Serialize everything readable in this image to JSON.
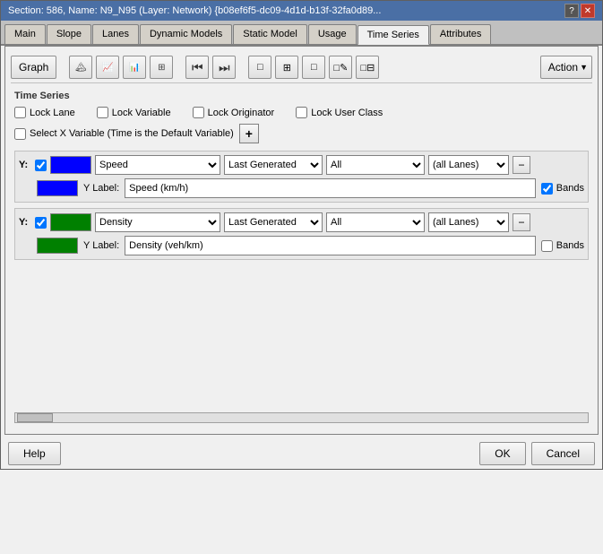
{
  "titleBar": {
    "text": "Section: 586, Name: N9_N95 (Layer: Network) {b08ef6f5-dc09-4d1d-b13f-32fa0d89...",
    "helpBtn": "?",
    "closeBtn": "✕"
  },
  "tabs": {
    "items": [
      "Main",
      "Slope",
      "Lanes",
      "Dynamic Models",
      "Static Model",
      "Usage",
      "Time Series",
      "Attributes"
    ],
    "active": "Time Series"
  },
  "toolbar": {
    "graphLabel": "Graph",
    "actionLabel": "Action",
    "icons": {
      "img1": "🖼",
      "img2": "🖼",
      "img3": "🖼",
      "img4": "⊞",
      "skipBack": "⏮",
      "skipFwd": "⏭",
      "sq1": "□",
      "grid1": "⊟",
      "sq2": "□",
      "sq3": "□",
      "sq4": "□"
    }
  },
  "timeSeries": {
    "sectionLabel": "Time Series",
    "checkboxes": {
      "lockLane": "Lock Lane",
      "lockVariable": "Lock Variable",
      "lockOriginator": "Lock Originator",
      "lockUserClass": "Lock User Class"
    },
    "xVariable": {
      "label": "Select X Variable (Time is the Default Variable)"
    },
    "series": [
      {
        "yLabel": "Y:",
        "colorClass": "blue",
        "variable": "Speed",
        "generated": "Last Generated",
        "all": "All",
        "lanes": "(all Lanes)",
        "labelText": "Y Label:",
        "labelValue": "Speed (km/h)",
        "bandsChecked": true,
        "bandsLabel": "Bands"
      },
      {
        "yLabel": "Y:",
        "colorClass": "green",
        "variable": "Density",
        "generated": "Last Generated",
        "all": "All",
        "lanes": "(all Lanes)",
        "labelText": "Y Label:",
        "labelValue": "Density (veh/km)",
        "bandsChecked": false,
        "bandsLabel": "Bands"
      }
    ]
  },
  "bottomBar": {
    "helpLabel": "Help",
    "okLabel": "OK",
    "cancelLabel": "Cancel"
  }
}
